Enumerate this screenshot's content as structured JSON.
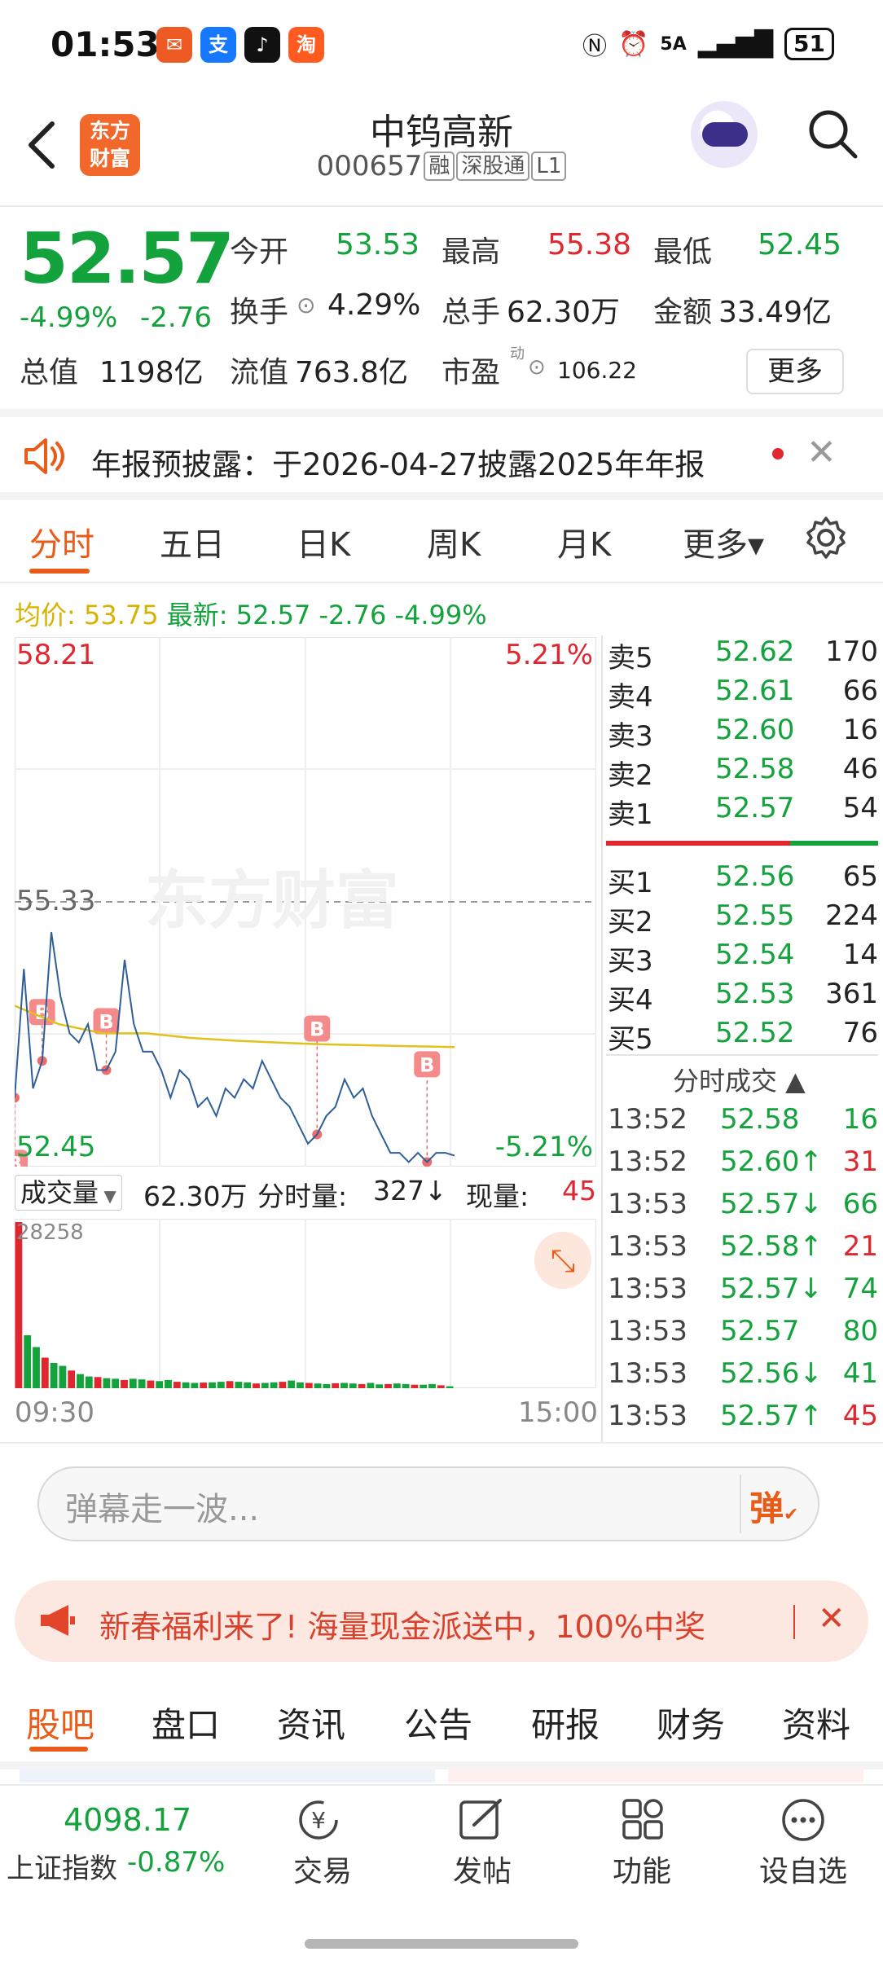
{
  "status_bar": {
    "time": "01:53",
    "network": "5A",
    "battery": "51"
  },
  "header": {
    "logo_line1": "东方",
    "logo_line2": "财富",
    "stock_name": "中钨高新",
    "stock_code": "000657",
    "tags": [
      "融",
      "深股通",
      "L1"
    ]
  },
  "quote": {
    "price": "52.57",
    "change_pct": "-4.99%",
    "change": "-2.76",
    "rows": [
      [
        {
          "label": "今开",
          "value": "53.53",
          "color": "green"
        },
        {
          "label": "最高",
          "value": "55.38",
          "color": "red"
        },
        {
          "label": "最低",
          "value": "52.45",
          "color": "green"
        }
      ],
      [
        {
          "label": "换手",
          "value": "4.29%",
          "color": "dark"
        },
        {
          "label": "总手",
          "value": "62.30万",
          "color": "dark"
        },
        {
          "label": "金额",
          "value": "33.49亿",
          "color": "dark"
        }
      ],
      [
        {
          "label": "总值",
          "value": "1198亿",
          "color": "dark"
        },
        {
          "label": "流值",
          "value": "763.8亿",
          "color": "dark"
        },
        {
          "label": "市盈",
          "value": "106.22",
          "color": "dark"
        }
      ]
    ],
    "pe_super": "动",
    "more_label": "更多"
  },
  "notice": {
    "text": "年报预披露：于2026-04-27披露2025年年报"
  },
  "chart_tabs": [
    "分时",
    "五日",
    "日K",
    "周K",
    "月K",
    "更多▾"
  ],
  "intraday": {
    "avg_label": "均价:",
    "avg_value": "53.75",
    "latest_label": "最新:",
    "latest_text": "52.57 -2.76 -4.99%",
    "watermark": "东方财富",
    "volume_label": "成交量",
    "volume_value": "62.30万",
    "interval_label": "分时量:",
    "interval_value": "327↓",
    "current_label": "现量:",
    "current_value": "45",
    "vol_max_label": "28258",
    "time_start": "09:30",
    "time_end": "15:00"
  },
  "chart_data": {
    "type": "line",
    "title": "",
    "y_axis_left": {
      "max": "58.21",
      "mid": "55.33",
      "min": "52.45"
    },
    "y_axis_right": {
      "max": "5.21%",
      "min": "-5.21%"
    },
    "ylim": [
      52.45,
      58.21
    ],
    "prev_close": 55.33,
    "x_range": [
      "09:30",
      "15:00"
    ],
    "series": [
      {
        "values": [
          53.2,
          54.6,
          53.3,
          53.6,
          55.0,
          54.3,
          53.9,
          53.8,
          54.0,
          53.5,
          53.5,
          53.7,
          54.7,
          54.0,
          53.7,
          53.7,
          53.5,
          53.2,
          53.5,
          53.4,
          53.1,
          53.2,
          53.0,
          53.3,
          53.2,
          53.4,
          53.3,
          53.6,
          53.4,
          53.2,
          53.1,
          52.9,
          52.7,
          52.8,
          53.0,
          53.1,
          53.4,
          53.2,
          53.3,
          53.0,
          52.8,
          52.6,
          52.6,
          52.5,
          52.6,
          52.5,
          52.6,
          52.6,
          52.57
        ]
      },
      {
        "values": [
          54.2,
          54.0,
          53.9,
          53.9,
          53.85,
          53.82,
          53.8,
          53.78,
          53.77,
          53.76,
          53.75
        ]
      }
    ],
    "volume": [
      28258,
      9000,
      7000,
      5200,
      4300,
      3800,
      3000,
      2400,
      2000,
      1900,
      1700,
      1600,
      1400,
      1600,
      1500,
      1300,
      1200,
      1400,
      1100,
      1000,
      900,
      950,
      1000,
      1100,
      1200,
      1100,
      1000,
      800,
      900,
      1000,
      1100,
      1300,
      1000,
      900,
      800,
      700,
      850,
      900,
      800,
      700,
      900,
      650,
      700,
      800,
      700,
      600,
      600,
      700,
      500,
      327
    ],
    "markers": [
      "B",
      "B",
      "B",
      "B",
      "B"
    ],
    "grid": true
  },
  "order_book": {
    "sell": [
      {
        "label": "卖5",
        "price": "52.62",
        "vol": "170"
      },
      {
        "label": "卖4",
        "price": "52.61",
        "vol": "66"
      },
      {
        "label": "卖3",
        "price": "52.60",
        "vol": "16"
      },
      {
        "label": "卖2",
        "price": "52.58",
        "vol": "46"
      },
      {
        "label": "卖1",
        "price": "52.57",
        "vol": "54"
      }
    ],
    "buy": [
      {
        "label": "买1",
        "price": "52.56",
        "vol": "65"
      },
      {
        "label": "买2",
        "price": "52.55",
        "vol": "224"
      },
      {
        "label": "买3",
        "price": "52.54",
        "vol": "14"
      },
      {
        "label": "买4",
        "price": "52.53",
        "vol": "361"
      },
      {
        "label": "买5",
        "price": "52.52",
        "vol": "76"
      }
    ],
    "trades_title": "分时成交 ▲",
    "trades": [
      {
        "time": "13:52",
        "price": "52.58",
        "vol": "16",
        "pc": "green",
        "vc": "green"
      },
      {
        "time": "13:52",
        "price": "52.60↑",
        "vol": "31",
        "pc": "green",
        "vc": "red"
      },
      {
        "time": "13:53",
        "price": "52.57↓",
        "vol": "66",
        "pc": "green",
        "vc": "green"
      },
      {
        "time": "13:53",
        "price": "52.58↑",
        "vol": "21",
        "pc": "green",
        "vc": "red"
      },
      {
        "time": "13:53",
        "price": "52.57↓",
        "vol": "74",
        "pc": "green",
        "vc": "green"
      },
      {
        "time": "13:53",
        "price": "52.57",
        "vol": "80",
        "pc": "green",
        "vc": "green"
      },
      {
        "time": "13:53",
        "price": "52.56↓",
        "vol": "41",
        "pc": "green",
        "vc": "green"
      },
      {
        "time": "13:53",
        "price": "52.57↑",
        "vol": "45",
        "pc": "green",
        "vc": "red"
      }
    ]
  },
  "chat": {
    "placeholder": "弹幕走一波...",
    "danmu_label": "弹"
  },
  "banner": {
    "text": "新春福利来了! 海量现金派送中，100%中奖"
  },
  "bottom_tabs": [
    "股吧",
    "盘口",
    "资讯",
    "公告",
    "研报",
    "财务",
    "资料"
  ],
  "bottom_bar": {
    "index_value": "4098.17",
    "index_name": "上证指数",
    "index_change": "-0.87%",
    "nav": [
      "交易",
      "发帖",
      "功能",
      "设自选"
    ]
  },
  "colors": {
    "up": "#e0262f",
    "down": "#14a23c",
    "accent": "#ea5b18",
    "avg_line": "#e0c21a",
    "price_line": "#2e5f99"
  }
}
